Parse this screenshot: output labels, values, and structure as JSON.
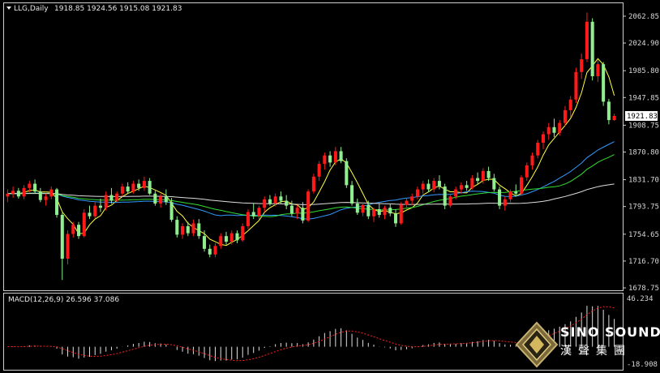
{
  "header": {
    "symbol_label": "LLG,Daily",
    "ohlc": "1918.85 1924.56 1915.08 1921.83"
  },
  "macd": {
    "label": "MACD(12,26,9) 26.596 37.086",
    "axis_top": "46.234",
    "axis_bottom": "-18.908"
  },
  "brand": {
    "name": "SINO SOUND",
    "chinese": "漢聲集團"
  },
  "colors": {
    "up": "#ff1a1a",
    "down": "#90ee90",
    "ma_yellow": "#ffff40",
    "ma_blue": "#3399ff",
    "ma_green": "#33dd33",
    "ma_white": "#dddddd",
    "macd_signal": "#ff2020"
  },
  "chart_data": {
    "type": "candlestick",
    "title": "LLG,Daily",
    "ohlc_current": {
      "open": 1918.85,
      "high": 1924.56,
      "low": 1915.08,
      "close": 1921.83
    },
    "price_axis_ticks": [
      2062.85,
      2024.9,
      1985.8,
      1947.85,
      1908.75,
      1870.8,
      1831.7,
      1793.75,
      1754.65,
      1716.7,
      1678.75
    ],
    "current_price_label": "1921.83",
    "ylim": [
      1676.5,
      2080.0
    ],
    "candles": [
      [
        1808,
        1818,
        1800,
        1812
      ],
      [
        1812,
        1822,
        1806,
        1816
      ],
      [
        1816,
        1820,
        1805,
        1808
      ],
      [
        1808,
        1824,
        1804,
        1820
      ],
      [
        1820,
        1830,
        1814,
        1826
      ],
      [
        1826,
        1832,
        1812,
        1815
      ],
      [
        1815,
        1820,
        1800,
        1803
      ],
      [
        1803,
        1812,
        1795,
        1808
      ],
      [
        1808,
        1822,
        1804,
        1818
      ],
      [
        1818,
        1820,
        1778,
        1782
      ],
      [
        1782,
        1785,
        1690,
        1720
      ],
      [
        1720,
        1760,
        1712,
        1755
      ],
      [
        1755,
        1772,
        1750,
        1768
      ],
      [
        1768,
        1772,
        1748,
        1752
      ],
      [
        1752,
        1790,
        1750,
        1785
      ],
      [
        1785,
        1795,
        1776,
        1780
      ],
      [
        1780,
        1800,
        1777,
        1795
      ],
      [
        1795,
        1805,
        1786,
        1792
      ],
      [
        1792,
        1815,
        1788,
        1810
      ],
      [
        1810,
        1820,
        1798,
        1802
      ],
      [
        1802,
        1815,
        1800,
        1812
      ],
      [
        1812,
        1826,
        1808,
        1822
      ],
      [
        1822,
        1828,
        1812,
        1815
      ],
      [
        1815,
        1830,
        1812,
        1826
      ],
      [
        1826,
        1832,
        1816,
        1820
      ],
      [
        1820,
        1836,
        1816,
        1830
      ],
      [
        1830,
        1834,
        1810,
        1812
      ],
      [
        1812,
        1816,
        1795,
        1798
      ],
      [
        1798,
        1812,
        1792,
        1808
      ],
      [
        1808,
        1818,
        1796,
        1800
      ],
      [
        1800,
        1806,
        1772,
        1775
      ],
      [
        1775,
        1780,
        1750,
        1754
      ],
      [
        1754,
        1770,
        1748,
        1766
      ],
      [
        1766,
        1772,
        1752,
        1756
      ],
      [
        1756,
        1775,
        1752,
        1770
      ],
      [
        1770,
        1776,
        1748,
        1752
      ],
      [
        1752,
        1760,
        1730,
        1734
      ],
      [
        1734,
        1740,
        1722,
        1726
      ],
      [
        1726,
        1742,
        1722,
        1738
      ],
      [
        1738,
        1756,
        1734,
        1752
      ],
      [
        1752,
        1758,
        1740,
        1744
      ],
      [
        1744,
        1760,
        1740,
        1756
      ],
      [
        1756,
        1760,
        1742,
        1746
      ],
      [
        1746,
        1770,
        1744,
        1766
      ],
      [
        1766,
        1790,
        1762,
        1786
      ],
      [
        1786,
        1798,
        1776,
        1780
      ],
      [
        1780,
        1795,
        1775,
        1792
      ],
      [
        1792,
        1808,
        1786,
        1804
      ],
      [
        1804,
        1810,
        1795,
        1798
      ],
      [
        1798,
        1812,
        1794,
        1808
      ],
      [
        1808,
        1815,
        1798,
        1802
      ],
      [
        1802,
        1810,
        1790,
        1795
      ],
      [
        1795,
        1802,
        1780,
        1784
      ],
      [
        1784,
        1796,
        1776,
        1792
      ],
      [
        1792,
        1800,
        1770,
        1774
      ],
      [
        1774,
        1818,
        1772,
        1815
      ],
      [
        1815,
        1840,
        1812,
        1836
      ],
      [
        1836,
        1858,
        1830,
        1854
      ],
      [
        1854,
        1870,
        1846,
        1866
      ],
      [
        1866,
        1872,
        1850,
        1856
      ],
      [
        1856,
        1878,
        1852,
        1872
      ],
      [
        1872,
        1878,
        1855,
        1858
      ],
      [
        1858,
        1862,
        1820,
        1824
      ],
      [
        1824,
        1830,
        1795,
        1798
      ],
      [
        1798,
        1805,
        1782,
        1785
      ],
      [
        1785,
        1800,
        1780,
        1796
      ],
      [
        1796,
        1802,
        1776,
        1780
      ],
      [
        1780,
        1792,
        1772,
        1790
      ],
      [
        1790,
        1798,
        1778,
        1782
      ],
      [
        1782,
        1795,
        1776,
        1792
      ],
      [
        1792,
        1798,
        1780,
        1784
      ],
      [
        1784,
        1790,
        1765,
        1770
      ],
      [
        1770,
        1800,
        1768,
        1796
      ],
      [
        1796,
        1806,
        1790,
        1802
      ],
      [
        1802,
        1812,
        1796,
        1808
      ],
      [
        1808,
        1822,
        1804,
        1818
      ],
      [
        1818,
        1830,
        1812,
        1826
      ],
      [
        1826,
        1832,
        1814,
        1818
      ],
      [
        1818,
        1834,
        1814,
        1830
      ],
      [
        1830,
        1838,
        1818,
        1822
      ],
      [
        1822,
        1826,
        1790,
        1795
      ],
      [
        1795,
        1812,
        1792,
        1808
      ],
      [
        1808,
        1822,
        1804,
        1818
      ],
      [
        1818,
        1828,
        1812,
        1824
      ],
      [
        1824,
        1830,
        1816,
        1820
      ],
      [
        1820,
        1838,
        1818,
        1834
      ],
      [
        1834,
        1842,
        1826,
        1830
      ],
      [
        1830,
        1848,
        1826,
        1844
      ],
      [
        1844,
        1850,
        1830,
        1834
      ],
      [
        1834,
        1840,
        1815,
        1818
      ],
      [
        1818,
        1822,
        1790,
        1795
      ],
      [
        1795,
        1808,
        1788,
        1804
      ],
      [
        1804,
        1818,
        1800,
        1815
      ],
      [
        1815,
        1825,
        1808,
        1812
      ],
      [
        1812,
        1838,
        1810,
        1835
      ],
      [
        1835,
        1856,
        1830,
        1852
      ],
      [
        1852,
        1870,
        1846,
        1866
      ],
      [
        1866,
        1888,
        1862,
        1884
      ],
      [
        1884,
        1900,
        1875,
        1896
      ],
      [
        1896,
        1912,
        1888,
        1906
      ],
      [
        1906,
        1918,
        1892,
        1898
      ],
      [
        1898,
        1916,
        1894,
        1912
      ],
      [
        1912,
        1936,
        1908,
        1930
      ],
      [
        1930,
        1950,
        1920,
        1945
      ],
      [
        1945,
        1990,
        1940,
        1984
      ],
      [
        1984,
        2010,
        1974,
        2002
      ],
      [
        2002,
        2068,
        1998,
        2055
      ],
      [
        2055,
        2060,
        1972,
        1978
      ],
      [
        1978,
        2002,
        1970,
        1995
      ],
      [
        1995,
        1998,
        1936,
        1942
      ],
      [
        1942,
        1946,
        1910,
        1916
      ],
      [
        1916,
        1925,
        1915,
        1921.83
      ]
    ],
    "moving_averages": [
      {
        "color": "#ffff40",
        "period": 5
      },
      {
        "color": "#3399ff",
        "period": 30
      },
      {
        "color": "#33dd33",
        "period": 40
      },
      {
        "color": "#dddddd",
        "period": 90
      }
    ],
    "macd": {
      "fast": 12,
      "slow": 26,
      "signal": 9,
      "main_value": 26.596,
      "signal_value": 37.086,
      "ylim": [
        -18.908,
        46.234
      ]
    }
  }
}
